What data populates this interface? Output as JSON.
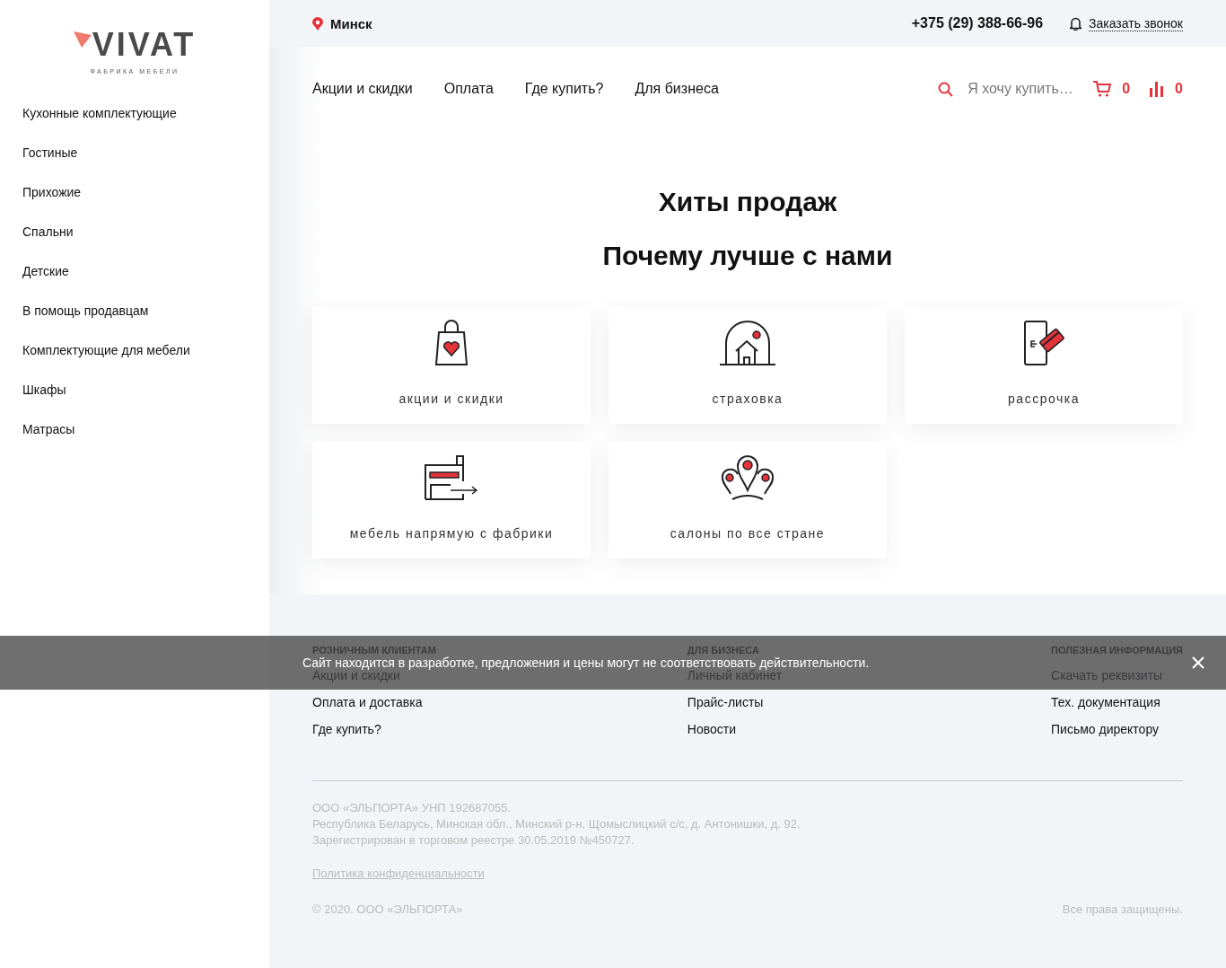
{
  "logo": {
    "wordmark": "VIVAT",
    "tagline": "ФАБРИКА МЕБЕЛИ"
  },
  "sidebar": {
    "items": [
      "Кухонные комплектующие",
      "Гостиные",
      "Прихожие",
      "Спальни",
      "Детские",
      "В помощь продавцам",
      "Комплектующие для мебели",
      "Шкафы",
      "Матрасы"
    ]
  },
  "top_bar": {
    "city": "Минск",
    "phone": "+375 (29) 388-66-96",
    "callback": "Заказать звонок"
  },
  "nav": {
    "items": [
      "Акции и скидки",
      "Оплата",
      "Где купить?",
      "Для бизнеса"
    ],
    "search": {
      "placeholder": "Я хочу купить…"
    },
    "cart_count": "0",
    "compare_count": "0"
  },
  "sections": [
    {
      "title": "Хиты продаж"
    },
    {
      "title": "Почему лучше с нами"
    }
  ],
  "features": [
    {
      "kind": "bag",
      "label": "акции и скидки"
    },
    {
      "kind": "house",
      "label": "страховка"
    },
    {
      "kind": "card",
      "label": "рассрочка"
    },
    {
      "kind": "factory",
      "label": "мебель напрямую с фабрики"
    },
    {
      "kind": "pins",
      "label": "салоны по все стране"
    }
  ],
  "footer": {
    "columns": [
      {
        "heading": "РОЗНИЧНЫМ КЛИЕНТАМ",
        "links": [
          "Акции и скидки",
          "Оплата и доставка",
          "Где купить?"
        ]
      },
      {
        "heading": "ДЛЯ БИЗНЕСА",
        "links": [
          "Личный кабинет",
          "Прайс-листы",
          "Новости"
        ]
      },
      {
        "heading": "ПОЛЕЗНАЯ ИНФОРМАЦИЯ",
        "links": [
          "Скачать реквизиты",
          "Тех. документация",
          "Письмо директору"
        ]
      }
    ],
    "legal": [
      "ООО «ЭЛЬПОРТА» УНП 192687055.",
      "Республика Беларусь, Минская обл., Минский р-н, Щомыслицкий с/с, д. Антонишки, д. 92.",
      "Зарегистрирован в торговом реестре 30.05.2019 №450727."
    ],
    "privacy_link": "Политика конфиденциальности",
    "copyright": "© 2020. ООО «ЭЛЬПОРТА»",
    "rights": "Все права защищены."
  },
  "notice": {
    "text": "Сайт находится в разработке, предложения и цены могут не соответствовать действительности."
  }
}
